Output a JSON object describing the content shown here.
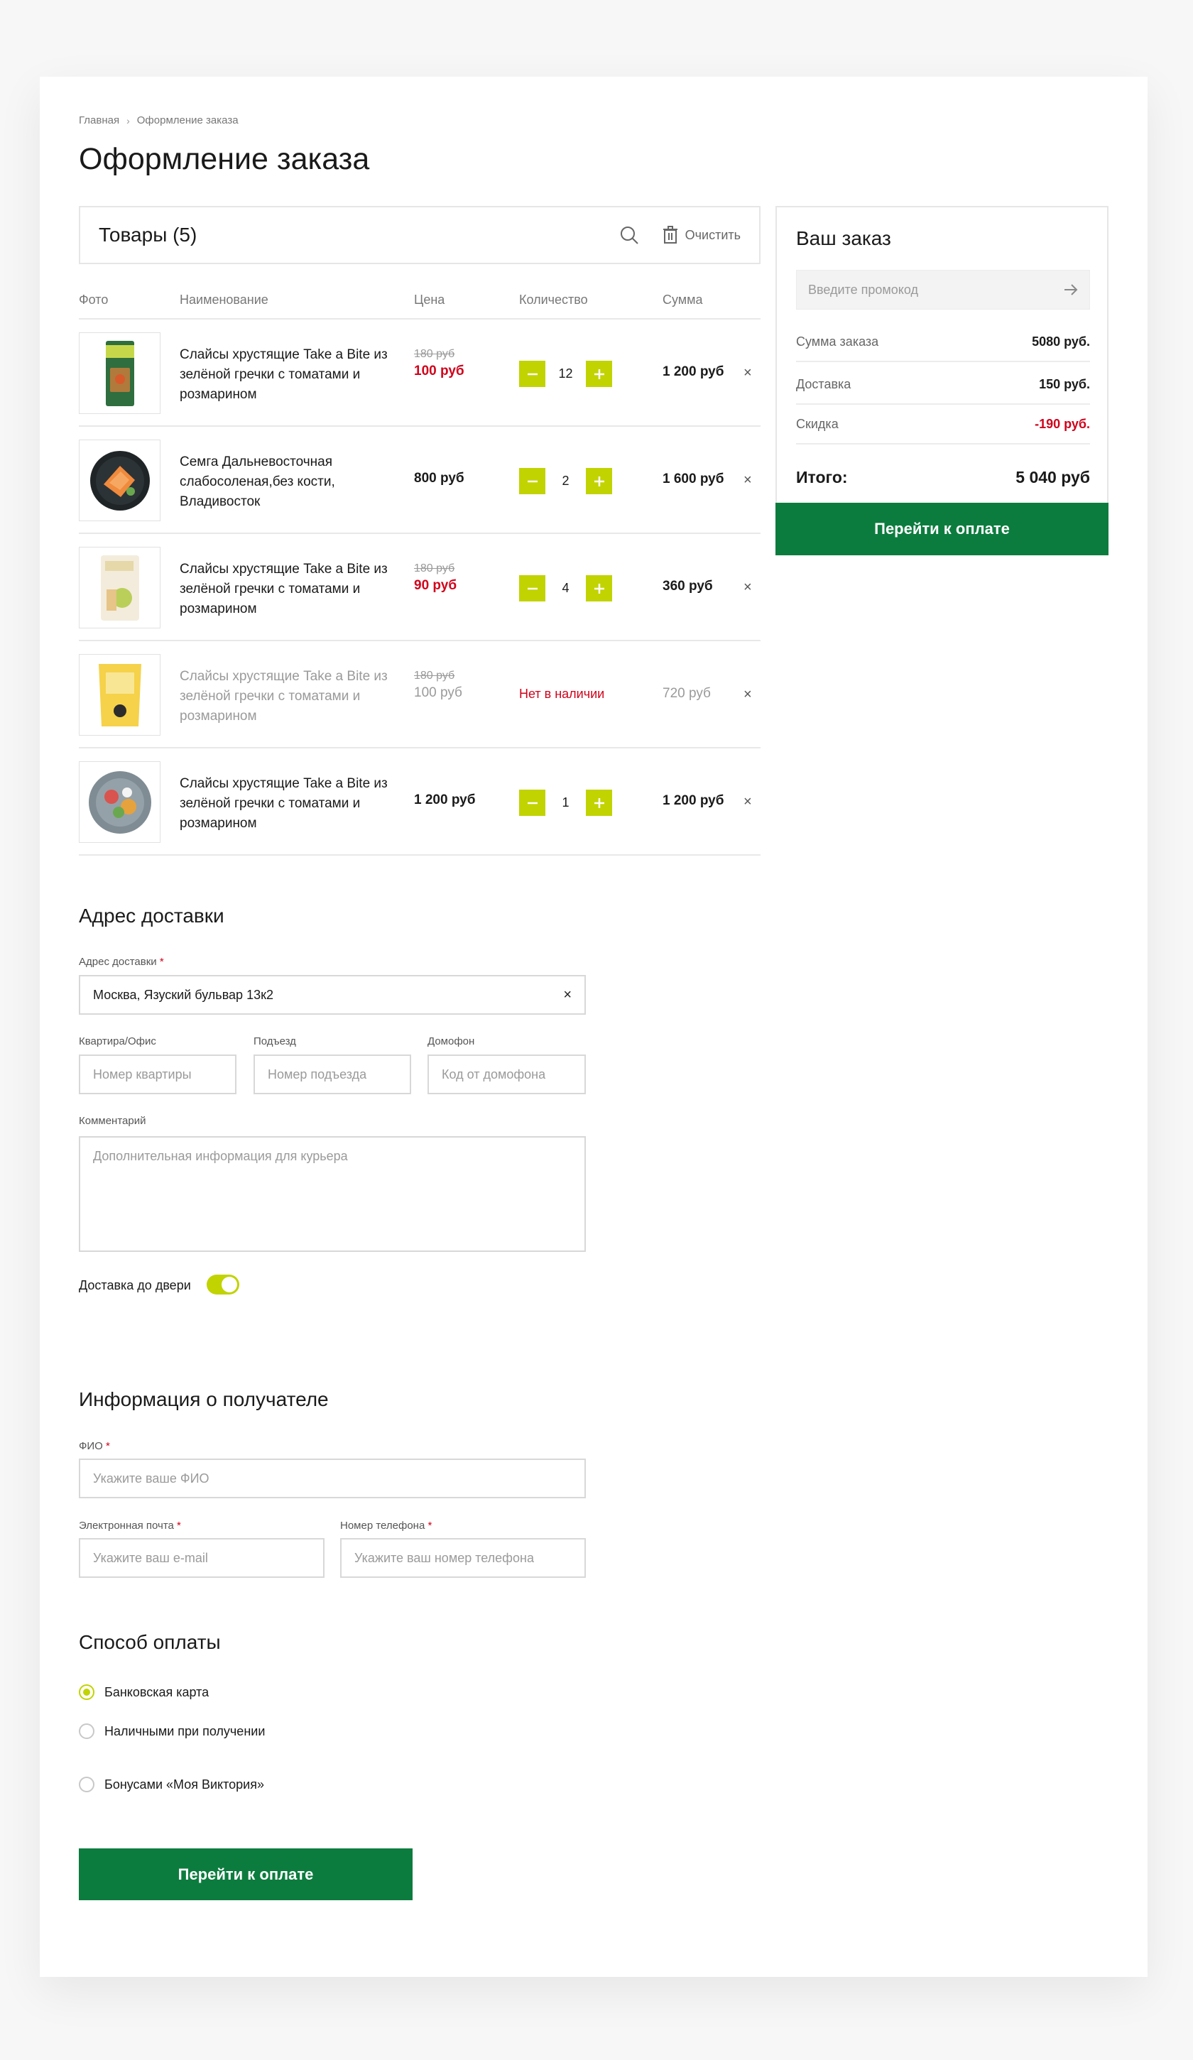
{
  "breadcrumb": {
    "home": "Главная",
    "current": "Оформление заказа"
  },
  "page_title": "Оформление заказа",
  "cart": {
    "title": "Товары (5)",
    "clear_label": "Очистить",
    "columns": {
      "photo": "Фото",
      "name": "Наименование",
      "price": "Цена",
      "quantity": "Количество",
      "sum": "Сумма"
    },
    "items": [
      {
        "name": "Слайсы хрустящие Take a Bite из зелёной гречки с томатами и розмарином",
        "old_price": "180 руб",
        "price": "100 руб",
        "quantity": "12",
        "sum": "1 200 руб"
      },
      {
        "name": "Семга Дальневосточная слабосоленая,без кости, Владивосток",
        "price": "800 руб",
        "quantity": "2",
        "sum": "1 600 руб"
      },
      {
        "name": "Слайсы хрустящие Take a Bite из зелёной гречки с томатами и розмарином",
        "old_price": "180 руб",
        "price": "90 руб",
        "quantity": "4",
        "sum": "360 руб"
      },
      {
        "name": "Слайсы хрустящие Take a Bite из зелёной гречки с томатами и розмарином",
        "old_price": "180 руб",
        "price": "100 руб",
        "status": "Нет в наличии",
        "sum": "720 руб"
      },
      {
        "name": "Слайсы хрустящие Take a Bite из зелёной гречки с томатами и розмарином",
        "price": "1 200 руб",
        "quantity": "1",
        "sum": "1 200 руб"
      }
    ],
    "remove_glyph": "×"
  },
  "summary": {
    "title": "Ваш заказ",
    "promo_placeholder": "Введите промокод",
    "order_sum_label": "Сумма заказа",
    "order_sum": "5080 руб.",
    "delivery_label": "Доставка",
    "delivery": "150 руб.",
    "discount_label": "Скидка",
    "discount": "-190 руб.",
    "total_label": "Итого:",
    "total": "5 040 руб",
    "pay_button": "Перейти к оплате"
  },
  "delivery": {
    "title": "Адрес доставки",
    "address_label": "Адрес доставки",
    "address_value": "Москва, Язуский бульвар 13к2",
    "apartment_label": "Квартира/Офис",
    "apartment_placeholder": "Номер квартиры",
    "entrance_label": "Подъезд",
    "entrance_placeholder": "Номер подъезда",
    "intercom_label": "Домофон",
    "intercom_placeholder": "Код от домофона",
    "comment_label": "Комментарий",
    "comment_placeholder": "Дополнительная информация для курьера",
    "door_delivery_label": "Доставка до двери"
  },
  "recipient": {
    "title": "Информация о получателе",
    "name_label": "ФИО",
    "name_placeholder": "Укажите ваше ФИО",
    "email_label": "Электронная почта",
    "email_placeholder": "Укажите ваш e-mail",
    "phone_label": "Номер телефона",
    "phone_placeholder": "Укажите ваш номер телефона",
    "required_mark": "*"
  },
  "payment": {
    "title": "Способ оплаты",
    "options": [
      "Банковская карта",
      "Наличными при получении",
      "Бонусами «Моя Виктория»"
    ],
    "selected": "Банковская карта",
    "submit": "Перейти к оплате"
  },
  "colors": {
    "accent": "#c1d300",
    "primary": "#0c7c3e",
    "danger": "#d0021b"
  }
}
